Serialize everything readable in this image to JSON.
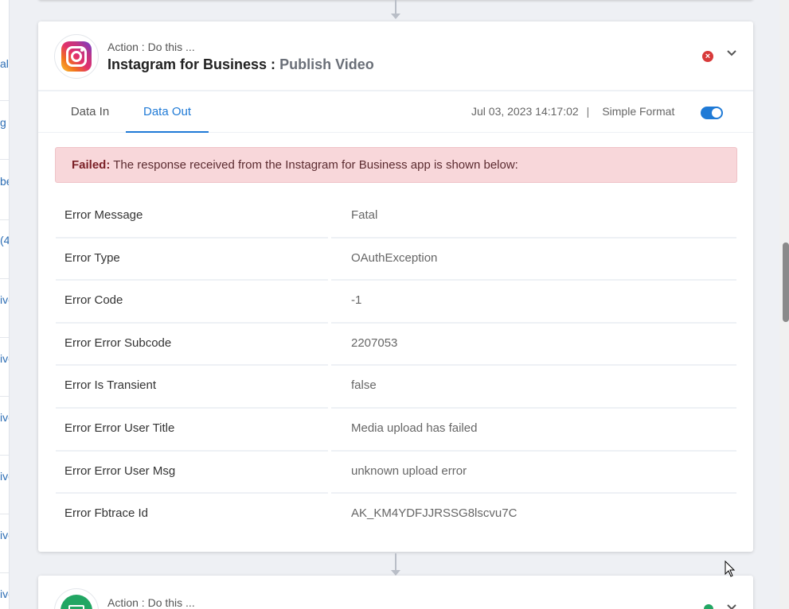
{
  "sidebar_fragments": [
    "al",
    "g",
    "be",
    "(4",
    "ive",
    "ive",
    "ive",
    "ive",
    "ive",
    "ive"
  ],
  "action_card": {
    "action_label": "Action : Do this ...",
    "app_name": "Instagram for Business :",
    "action_name": "Publish Video",
    "status": "error",
    "tabs": [
      {
        "label": "Data In",
        "active": false
      },
      {
        "label": "Data Out",
        "active": true
      }
    ],
    "timestamp": "Jul 03, 2023 14:17:02",
    "separator": "|",
    "format_label": "Simple Format",
    "format_toggle_on": true,
    "alert": {
      "prefix": "Failed:",
      "message": "The response received from the Instagram for Business app is shown below:"
    },
    "rows": [
      {
        "key": "Error Message",
        "value": "Fatal"
      },
      {
        "key": "Error Type",
        "value": "OAuthException"
      },
      {
        "key": "Error Code",
        "value": "-1"
      },
      {
        "key": "Error Error Subcode",
        "value": "2207053"
      },
      {
        "key": "Error Is Transient",
        "value": "false"
      },
      {
        "key": "Error Error User Title",
        "value": "Media upload has failed"
      },
      {
        "key": "Error Error User Msg",
        "value": "unknown upload error"
      },
      {
        "key": "Error Fbtrace Id",
        "value": "AK_KM4YDFJJRSSG8lscvu7C"
      }
    ]
  },
  "next_card": {
    "action_label": "Action : Do this ...",
    "status": "success"
  },
  "colors": {
    "accent": "#1f7ad6",
    "error": "#d83a3a",
    "success": "#22a663",
    "alert_bg": "#f8d7da"
  }
}
